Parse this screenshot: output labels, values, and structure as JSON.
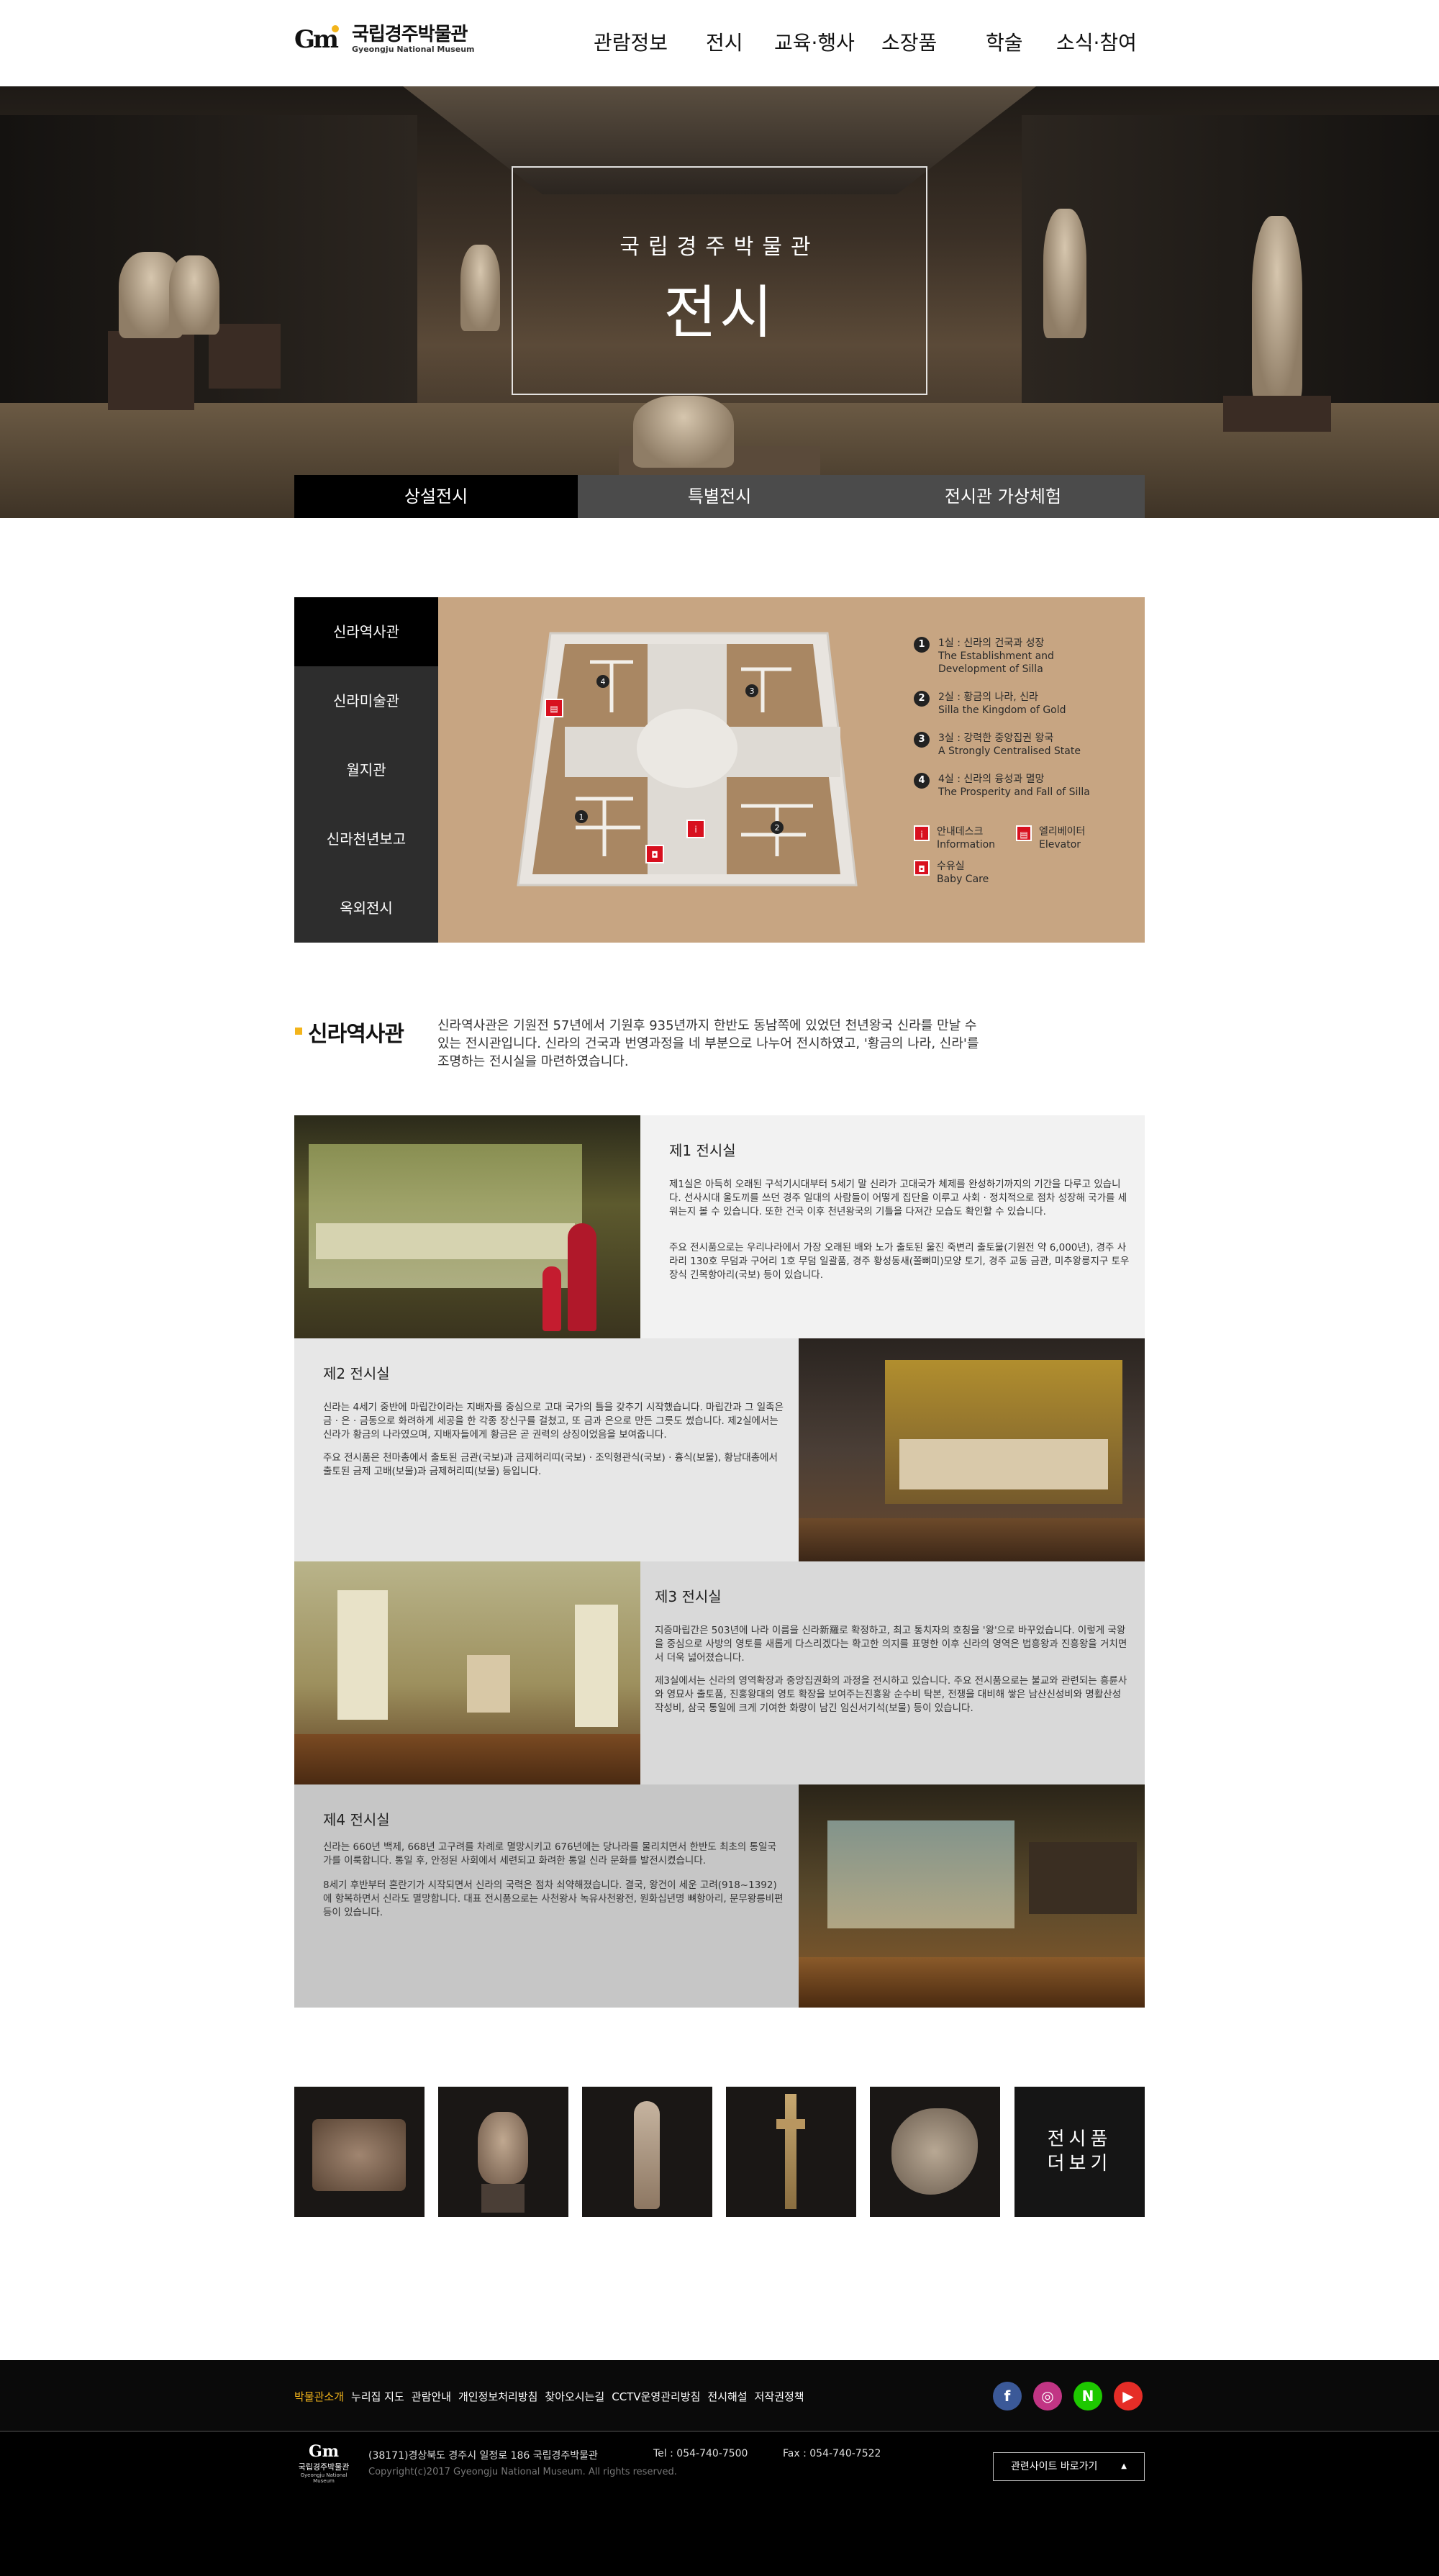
{
  "header": {
    "logo_mark": "Gm",
    "logo_ko": "국립경주박물관",
    "logo_en": "Gyeongju National Museum",
    "nav": [
      "관람정보",
      "전시",
      "교육·행사",
      "소장품",
      "학술",
      "소식·참여"
    ]
  },
  "hero": {
    "subtitle": "국립경주박물관",
    "title": "전시"
  },
  "tabs": [
    "상설전시",
    "특별전시",
    "전시관 가상체험"
  ],
  "sidebar": {
    "items": [
      "신라역사관",
      "신라미술관",
      "월지관",
      "신라천년보고",
      "옥외전시"
    ],
    "active": "신라역사관"
  },
  "floor_legend": {
    "rooms": [
      {
        "num": "1",
        "text": "1실 : 신라의 건국과 성장\nThe Establishment and\nDevelopment of Silla"
      },
      {
        "num": "2",
        "text": "2실 : 황금의 나라, 신라\nSilla the Kingdom of Gold"
      },
      {
        "num": "3",
        "text": "3실 : 강력한 중앙집권 왕국\nA Strongly Centralised State"
      },
      {
        "num": "4",
        "text": "4실 : 신라의 융성과 멸망\nThe Prosperity and Fall of Silla"
      }
    ],
    "facilities": [
      {
        "icon": "info-icon",
        "text": "안내데스크\nInformation"
      },
      {
        "icon": "elevator-icon",
        "text": "엘리베이터\nElevator"
      },
      {
        "icon": "baby-care-icon",
        "text": "수유실\nBaby Care"
      }
    ]
  },
  "intro": {
    "title": "신라역사관",
    "description": "신라역사관은 기원전 57년에서 기원후 935년까지 한반도 동남쪽에 있었던 천년왕국 신라를 만날 수 있는 전시관입니다. 신라의 건국과 번영과정을 네 부분으로 나누어 전시하였고, '황금의 나라, 신라'를 조명하는 전시실을 마련하였습니다."
  },
  "galleries": [
    {
      "title": "제1 전시실",
      "p1": "제1실은 아득히 오래된 구석기시대부터 5세기 말 신라가 고대국가 체제를 완성하기까지의 기간을 다루고 있습니다. 선사시대 울도끼를 쓰던 경주 일대의 사람들이 어떻게 집단을 이루고 사회 · 정치적으로 점차 성장해 국가를 세워는지 볼 수 있습니다. 또한 건국 이후 천년왕국의 기틀을 다져간 모습도 확인할 수 있습니다.",
      "p2": "주요 전시품으로는 우리나라에서 가장 오래된 배와 노가 출토된 울진 죽변리 출토물(기원전 약 6,000년), 경주 사라리 130호 무덤과 구어리 1호 무덤 일괄품, 경주 황성동새(쫄뼈미)모양 토기, 경주 교동 금관, 미추왕릉지구 토우장식 긴목항아리(국보) 등이 있습니다."
    },
    {
      "title": "제2 전시실",
      "p1": "신라는 4세기 중반에 마립간이라는 지배자를 중심으로 고대 국가의 틀을 갖추기 시작했습니다. 마립간과 그 일족은 금 · 은 · 금동으로 화려하게 세공을 한 각종 장신구를 걸쳤고, 또 금과 은으로 만든 그릇도 썼습니다. 제2실에서는 신라가 황금의 나라였으며, 지배자들에게 황금은 곧 권력의 상징이었음을 보여줍니다.",
      "p2": "주요 전시품은 천마총에서 출토된 금관(국보)과 금제허리띠(국보) · 조익형관식(국보) · 흉식(보물), 황남대총에서 출토된 금제 고배(보물)과 금제허리띠(보물) 등입니다."
    },
    {
      "title": "제3 전시실",
      "p1": "지증마립간은 503년에 나라 이름을 신라新羅로 확정하고, 최고 통치자의 호칭을 '왕'으로 바꾸었습니다. 이렇게 국왕을 중심으로 사방의 영토를 새롭게 다스리겠다는 확고한 의지를 표명한 이후 신라의 영역은 법흥왕과 진흥왕을 거치면서 더욱 넓어졌습니다.",
      "p2": "제3실에서는 신라의 영역확장과 중앙집권화의 과정을 전시하고 있습니다. 주요 전시품으로는 불교와 관련되는 흥륜사와 영묘사 출토품, 진흥왕대의 영토 확장을 보여주는진흥왕 순수비 탁본, 전쟁을 대비해 쌓은 남산신성비와 명활산성작성비, 삼국 통일에 크게 기여한 화랑이 남긴 임신서기석(보물) 등이 있습니다."
    },
    {
      "title": "제4 전시실",
      "p1": "신라는 660년 백제, 668년 고구려를 차례로 멸망시키고 676년에는 당나라를 물리치면서 한반도 최초의 통일국가를 이룩합니다. 통일 후, 안정된 사회에서 세련되고 화려한 통일 신라 문화를 발전시켰습니다.",
      "p2": "8세기 후반부터 혼란기가 시작되면서 신라의 국력은 점차 쇠약해졌습니다. 결국, 왕건이 세운 고려(918~1392)에 항복하면서 신라도 멸망합니다. 대표 전시품으로는 사천왕사 녹유사천왕전, 원화십년명 뼈항아리, 문무왕릉비편 등이 있습니다."
    }
  ],
  "more_button": {
    "line1": "전시품",
    "line2": "더보기"
  },
  "footer": {
    "links": [
      "박물관소개",
      "누리집 지도",
      "관람안내",
      "개인정보처리방침",
      "찾아오시는길",
      "CCTV운영관리방침",
      "전시해설",
      "저작권정책"
    ],
    "sns": [
      {
        "name": "facebook-icon",
        "glyph": "f",
        "color": "#3b5998"
      },
      {
        "name": "instagram-icon",
        "glyph": "◎",
        "color": "#c13584"
      },
      {
        "name": "naver-icon",
        "glyph": "N",
        "color": "#1ec800"
      },
      {
        "name": "youtube-icon",
        "glyph": "▶",
        "color": "#e52d27"
      }
    ],
    "logo_mark": "Gm",
    "logo_ko": "국립경주박물관",
    "logo_en": "Gyeongju National Museum",
    "address": "(38171)경상북도 경주시 일정로 186 국립경주박물관",
    "tel": "Tel : 054-740-7500",
    "fax": "Fax : 054-740-7522",
    "copyright": "Copyright(c)2017 Gyeongju National Museum. All rights reserved.",
    "related_sites": "관련사이트 바로가기"
  }
}
